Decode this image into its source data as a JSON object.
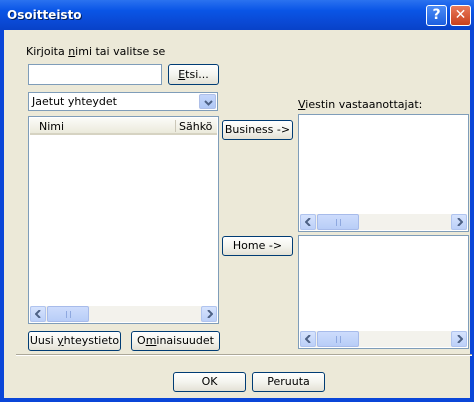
{
  "window": {
    "title": "Osoitteisto"
  },
  "search": {
    "prompt_pre": "Kirjoita ",
    "prompt_u": "n",
    "prompt_post": "imi tai valitse se",
    "value": "",
    "find_u": "E",
    "find_post": "tsi..."
  },
  "contacts_source": {
    "selected": "Jaetut yhteydet"
  },
  "contact_list": {
    "columns": [
      "Nimi",
      "Sähkö"
    ],
    "rows": []
  },
  "recipients_label_u": "V",
  "recipients_label_post": "iestin vastaanottajat:",
  "buttons": {
    "business": "Business ->",
    "home": "Home ->",
    "new_contact_pre": "Uusi ",
    "new_contact_u": "y",
    "new_contact_post": "hteystieto",
    "props_pre": "O",
    "props_u": "m",
    "props_post": "inaisuudet",
    "ok": "OK",
    "cancel": "Peruuta"
  }
}
